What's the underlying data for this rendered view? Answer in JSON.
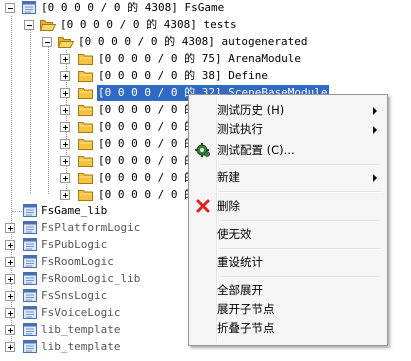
{
  "tree": {
    "root": {
      "label": "[0 0 0 0 / 0 的 4308] FsGame"
    },
    "tests": {
      "label": "[0 0 0 0 / 0 的 4308] tests"
    },
    "autogenerated": {
      "label": "[0 0 0 0 / 0 的 4308] autogenerated"
    },
    "modules": [
      {
        "label": "[0 0 0 0 / 0 的 75] ArenaModule"
      },
      {
        "label": "[0 0 0 0 / 0 的 38] Define"
      },
      {
        "label": "[0 0 0 0 / 0 的 32] SceneBaseModule"
      },
      {
        "label": "[0 0 0 0 / 0 的"
      },
      {
        "label": "[0 0 0 0 / 0 的"
      },
      {
        "label": "[0 0 0 0 / 0 的"
      },
      {
        "label": "[0 0 0 0 / 0 的"
      },
      {
        "label": "[0 0 0 0 / 0 的"
      },
      {
        "label": "[0 0 0 0 / 0 的"
      }
    ],
    "lib": {
      "label": "FsGame_lib"
    },
    "projects": [
      {
        "label": "FsPlatformLogic"
      },
      {
        "label": "FsPubLogic"
      },
      {
        "label": "FsRoomLogic"
      },
      {
        "label": "FsRoomLogic_lib"
      },
      {
        "label": "FsSnsLogic"
      },
      {
        "label": "FsVoiceLogic"
      },
      {
        "label": "lib_template"
      },
      {
        "label": "lib_template"
      }
    ]
  },
  "context_menu": {
    "test_history": "测试历史 (H)",
    "test_run": "测试执行",
    "test_config": "测试配置 (C)...",
    "new": "新建",
    "delete": "删除",
    "disable": "使无效",
    "reset_stats": "重设统计",
    "expand_all": "全部展开",
    "expand_children": "展开子节点",
    "collapse_children": "折叠子节点"
  },
  "colors": {
    "selection": "#316ac5",
    "folder": "#f5c242",
    "delete_icon": "#e02020"
  }
}
